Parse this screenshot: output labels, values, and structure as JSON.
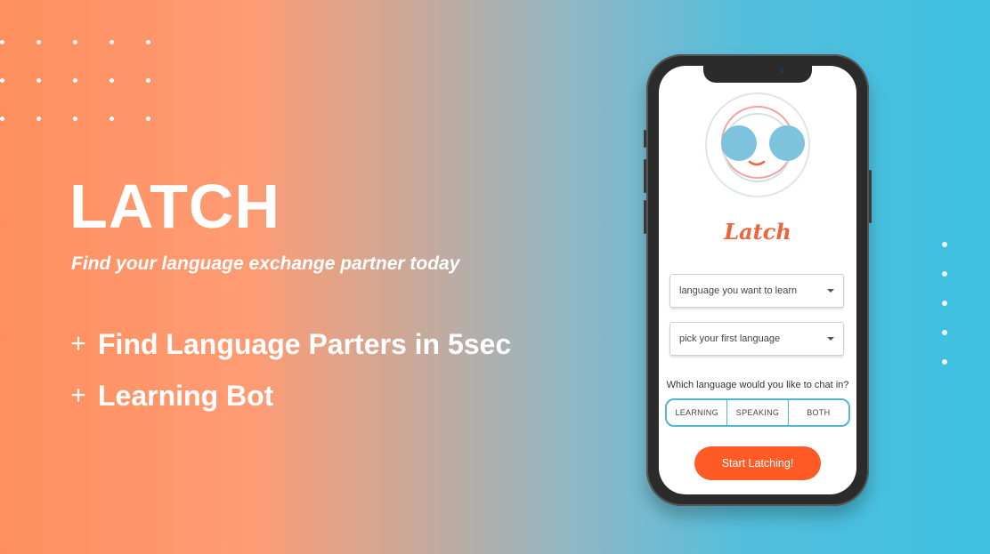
{
  "hero": {
    "title": "LATCH",
    "tagline": "Find your language exchange partner today",
    "features": [
      {
        "bullet": "+",
        "text": "Find Language Parters in 5sec"
      },
      {
        "bullet": "+",
        "text": "Learning Bot"
      }
    ]
  },
  "phone": {
    "brand_word": "Latch",
    "select_learn": "language you want to learn",
    "select_first": "pick your first language",
    "question": "Which language would you like to chat in?",
    "options": [
      "LEARNING",
      "SPEAKING",
      "BOTH"
    ],
    "cta": "Start Latching!"
  },
  "colors": {
    "accent_orange": "#ff5b26",
    "accent_blue": "#53b7d2",
    "face_blue": "#7dc3dd",
    "face_red": "#f0643a"
  },
  "icons": {
    "logo": "smiley-face-logo",
    "dropdown": "caret-down-icon"
  }
}
